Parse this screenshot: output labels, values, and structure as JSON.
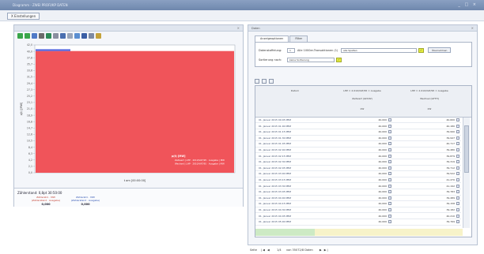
{
  "window": {
    "title": "Diagramm - ZWEI PROFI/KP DATEN",
    "controls": "_ □ ×"
  },
  "menu": {
    "button": "X Einstellungen"
  },
  "left_panel": {
    "close": "×",
    "toolbar_icons": [
      "back-icon",
      "forward-icon",
      "zoom-icon",
      "sum-icon",
      "chart-icon",
      "settings-icon",
      "print-icon",
      "table-icon",
      "export-icon",
      "save-icon",
      "copy-icon",
      "pin-icon"
    ],
    "stats": {
      "title": "Zählerstand: 0,8pt 30:50:00",
      "columns": [
        {
          "label": "Zählerstd. · MW (Zählerstand · Ausgabe)",
          "value": "0,000"
        },
        {
          "label": "Zählerstd. · MW (Zählerstand · Ausgabe)",
          "value": "0,000"
        }
      ]
    }
  },
  "right_panel": {
    "title": "Daten",
    "close": "×",
    "tabs": [
      "Anzeigeoptionen",
      "Filter"
    ],
    "filter": {
      "row1_label": "Datenstaffelung:",
      "row1_value": "1",
      "row1_unit": "Alle 1000er-Transaktionen (1)",
      "row1_select": "alle Spalten",
      "row1_button": "Übernehmen",
      "row2_label": "Sortierung nach:",
      "row2_select": "keine Sortierung"
    },
    "table": {
      "headers": {
        "date": "Datum",
        "col1": "LHP = 2.010/VAT/95 = Ausgabe",
        "col1_sub": "Zeitwert (GDVW)",
        "col1_unit": "kW",
        "col2": "LHP = 2.010/VAT/95 = Ausgabe",
        "col2_sub": "Wechsel (GTTH)",
        "col2_unit": "kW"
      },
      "rows": [
        {
          "date": "01. Januar 2015 00:45 MEZ",
          "v1": "40,000",
          "v2": "40,600"
        },
        {
          "date": "01. Januar 2015 01:00 MEZ",
          "v1": "40,000",
          "v2": "40,180"
        },
        {
          "date": "01. Januar 2015 01:15 MEZ",
          "v1": "40,000",
          "v2": "39,990"
        },
        {
          "date": "01. Januar 2015 01:30 MEZ",
          "v1": "40,000",
          "v2": "39,947"
        },
        {
          "date": "01. Januar 2015 01:45 MEZ",
          "v1": "40,000",
          "v2": "40,717"
        },
        {
          "date": "01. Januar 2015 02:00 MEZ",
          "v1": "40,000",
          "v2": "39,480"
        },
        {
          "date": "01. Januar 2015 02:15 MEZ",
          "v1": "40,000",
          "v2": "39,879"
        },
        {
          "date": "01. Januar 2015 02:30 MEZ",
          "v1": "40,000",
          "v2": "39,319"
        },
        {
          "date": "01. Januar 2015 02:45 MEZ",
          "v1": "40,000",
          "v2": "39,712"
        },
        {
          "date": "01. Januar 2015 03:00 MEZ",
          "v1": "40,000",
          "v2": "39,522"
        },
        {
          "date": "01. Januar 2015 03:15 MEZ",
          "v1": "40,000",
          "v2": "41,470"
        },
        {
          "date": "01. Januar 2015 03:30 MEZ",
          "v1": "40,000",
          "v2": "41,192"
        },
        {
          "date": "01. Januar 2015 03:45 MEZ",
          "v1": "40,000",
          "v2": "39,783"
        },
        {
          "date": "01. Januar 2015 04:00 MEZ",
          "v1": "40,000",
          "v2": "39,489"
        },
        {
          "date": "01. Januar 2015 04:15 MEZ",
          "v1": "40,000",
          "v2": "39,158"
        },
        {
          "date": "01. Januar 2015 04:30 MEZ",
          "v1": "40,000",
          "v2": "39,182"
        },
        {
          "date": "01. Januar 2015 04:45 MEZ",
          "v1": "40,000",
          "v2": "40,210"
        },
        {
          "date": "01. Januar 2015 05:00 MEZ",
          "v1": "40,000",
          "v2": "39,769"
        }
      ]
    }
  },
  "pager": {
    "label": "Seite",
    "current": "1/4",
    "of_text": "von 35072/8 Daten"
  },
  "chart_data": {
    "type": "bar",
    "ylabel": "p(t) [MW]",
    "xlabel": "t am [00:00:00]",
    "ylim": [
      0,
      42
    ],
    "yticks": [
      "0,0",
      "2,1",
      "4,2",
      "6,3",
      "8,4",
      "10,5",
      "12,6",
      "14,7",
      "16,8",
      "18,9",
      "21,0",
      "23,1",
      "25,2",
      "27,3",
      "29,4",
      "31,5",
      "33,6",
      "35,7",
      "37,8",
      "40,0",
      "42,0"
    ],
    "series": [
      {
        "name": "Zeitwert | LHP · 2010/VAT/95 · Ausgabe | MW",
        "value": 40.0,
        "color": "#f0545a"
      },
      {
        "name": "Wechsel | LHP · 2010/VAT/95 · Ausgabe | MW",
        "value": 40.6,
        "color": "#5466e0"
      }
    ],
    "legend_title": "p(t) [MW]",
    "legend": "bottom-right",
    "grid": false
  }
}
